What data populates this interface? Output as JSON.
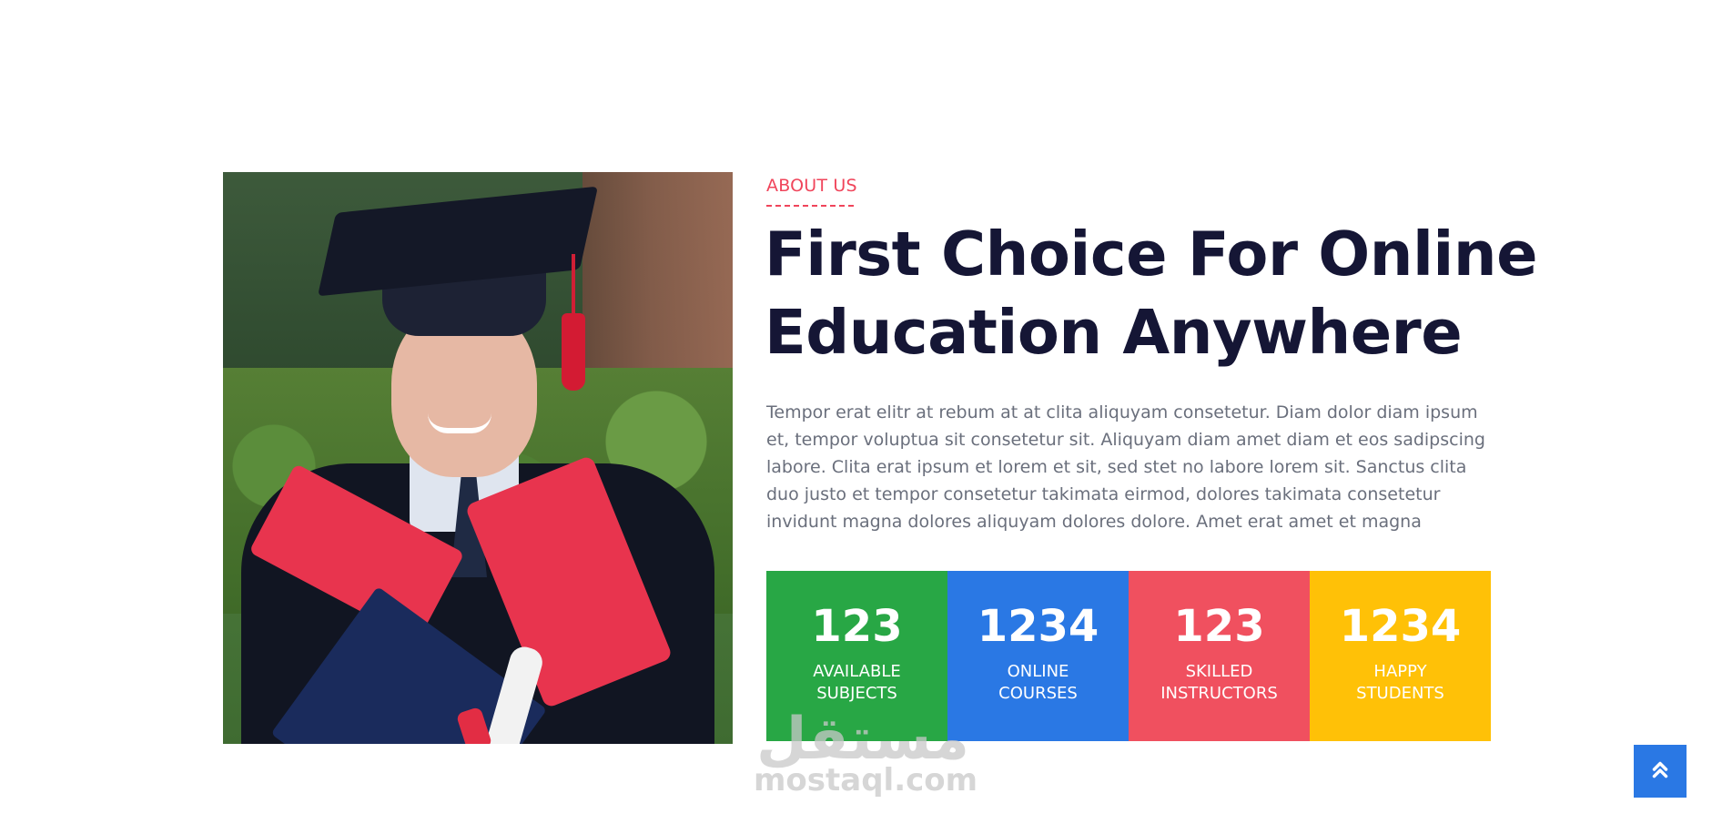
{
  "about": {
    "label": "ABOUT US",
    "title": "First Choice For Online Education Anywhere",
    "body": "Tempor erat elitr at rebum at at clita aliquyam consetetur. Diam dolor diam ipsum et, tempor voluptua sit consetetur sit. Aliquyam diam amet diam et eos sadipscing labore. Clita erat ipsum et lorem et sit, sed stet no labore lorem sit. Sanctus clita duo justo et tempor consetetur takimata eirmod, dolores takimata consetetur invidunt magna dolores aliquyam dolores dolore. Amet erat amet et magna"
  },
  "stats": [
    {
      "value": "123",
      "label": "AVAILABLE SUBJECTS",
      "color": "#28a745"
    },
    {
      "value": "1234",
      "label": "ONLINE COURSES",
      "color": "#2a78e4"
    },
    {
      "value": "123",
      "label": "SKILLED INSTRUCTORS",
      "color": "#f0505f"
    },
    {
      "value": "1234",
      "label": "HAPPY STUDENTS",
      "color": "#ffc107"
    }
  ],
  "watermark": {
    "arabic": "مستقل",
    "latin": "mostaql.com"
  },
  "icons": {
    "back_to_top": "double-chevron-up-icon"
  },
  "colors": {
    "accent": "#f0455b",
    "title": "#151635",
    "back_to_top_bg": "#2a78e4"
  }
}
